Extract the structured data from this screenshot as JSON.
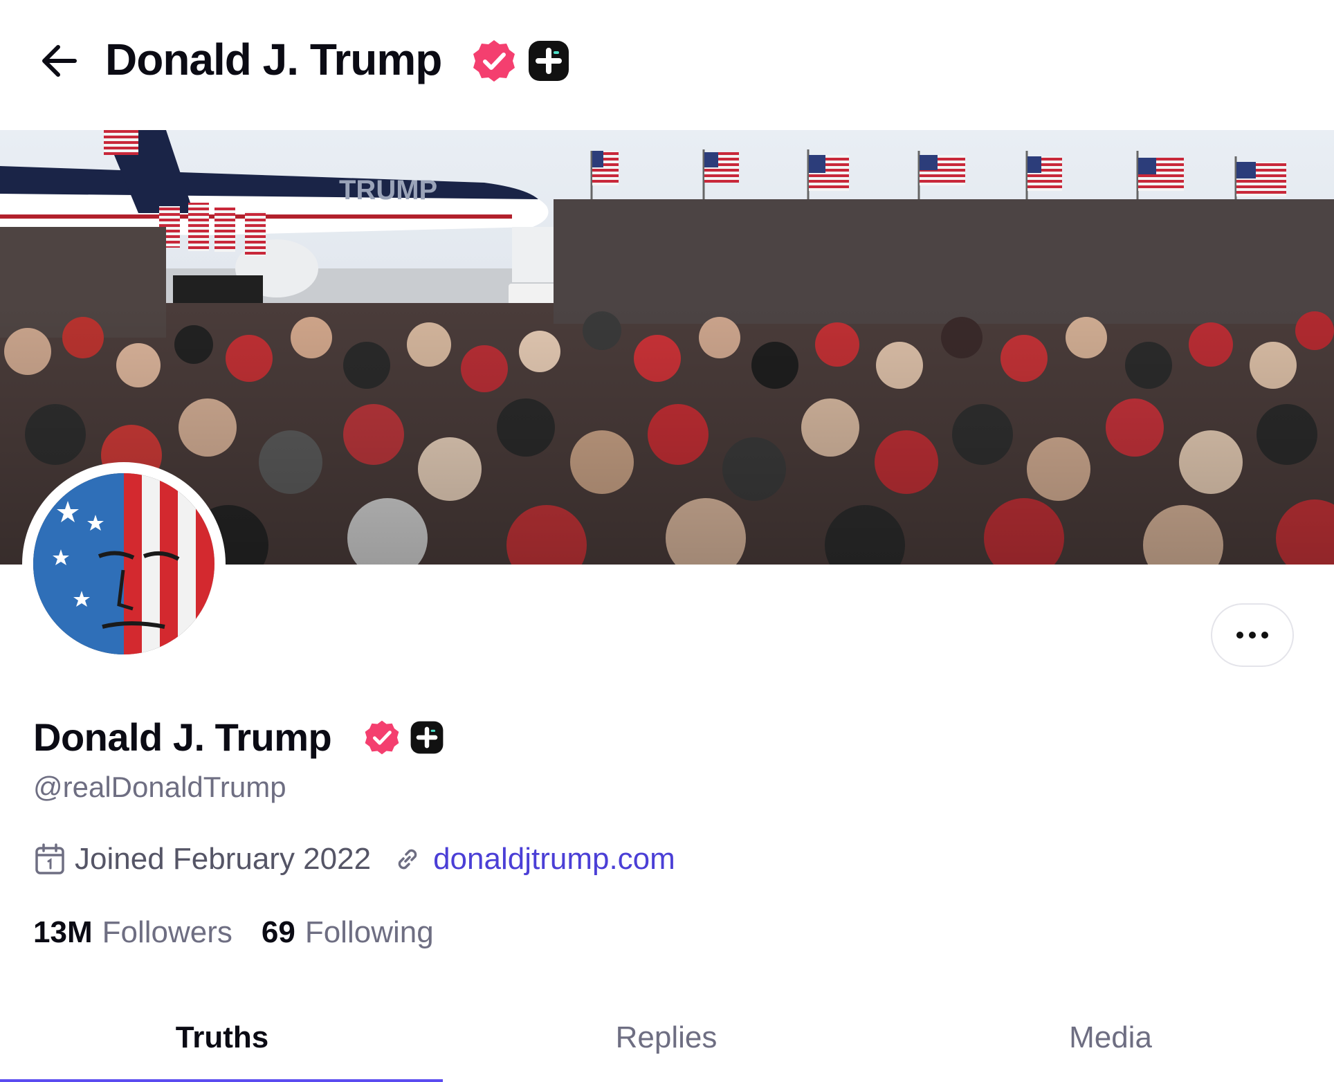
{
  "header": {
    "back_icon": "arrow-left-icon",
    "title": "Donald J. Trump"
  },
  "badges": {
    "verified_icon": "verified-badge-icon",
    "verified_color": "#f43f6f",
    "plus_icon": "plus-badge-icon",
    "plus_color": "#111111"
  },
  "banner": {
    "description_icon": "rally-crowd-banner-image",
    "plane_text": "TRUMP"
  },
  "avatar": {
    "icon": "profile-avatar-image"
  },
  "more_button": {
    "icon": "more-dots-icon"
  },
  "profile": {
    "name": "Donald J. Trump",
    "handle": "@realDonaldTrump",
    "joined": "Joined February 2022",
    "joined_icon": "calendar-icon",
    "link_icon": "link-icon",
    "website": "donaldjtrump.com",
    "link_color": "#4b3fd6"
  },
  "stats": {
    "followers_count": "13M",
    "followers_label": "Followers",
    "following_count": "69",
    "following_label": "Following"
  },
  "tabs": [
    {
      "label": "Truths",
      "active": true
    },
    {
      "label": "Replies",
      "active": false
    },
    {
      "label": "Media",
      "active": false
    }
  ],
  "accent_color": "#5b4cf0"
}
